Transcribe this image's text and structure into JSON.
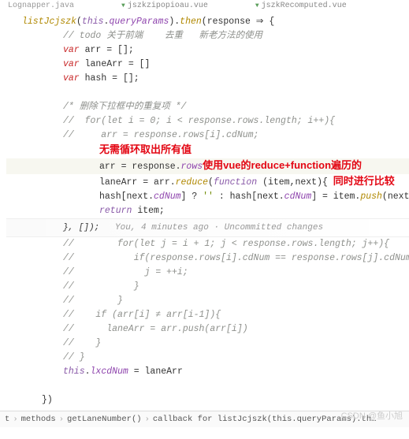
{
  "tabs": {
    "left": "Lognapper.java",
    "mid": "jszkzipopioau.vue",
    "right": "jszkRecomputed.vue"
  },
  "code": {
    "l1_a": "listJcjszk",
    "l1_b": "this",
    "l1_c": "queryParams",
    "l1_d": "then",
    "l1_e": "response",
    "l2": "// todo 关于前端    去重   新老方法的使用",
    "l3_kw": "var",
    "l3_v": "arr",
    "l3_val": " = [];",
    "l4_kw": "var",
    "l4_v": "laneArr",
    "l4_val": " = []",
    "l5_kw": "var",
    "l5_v": "hash",
    "l5_val": " = [];",
    "l6": "/* 删除下拉框中的重复项 */",
    "l7": "//  for(let i = 0; i < response.rows.length; i++){",
    "l8": "//     arr = response.rows[i].cdNum;",
    "anno1": "无需循环取出所有值",
    "l9_a": "arr = response.",
    "l9_b": "rows",
    "anno2": "使用vue的reduce+function遍历的",
    "l10_a": "laneArr = arr.",
    "l10_b": "reduce",
    "l10_c": "function",
    "l10_d": " (item,next){",
    "anno3": "同时进行比较",
    "l11_a": "hash[next.",
    "l11_b": "cdNum",
    "l11_c": "] ? ",
    "l11_d": "''",
    "l11_e": " : hash[next.",
    "l11_f": "cdNum",
    "l11_g": "] = item.",
    "l11_h": "push",
    "l11_i": "(next);",
    "l12_kw": "return",
    "l12_v": " item;",
    "l13": "}, []);",
    "vcs": "You, 4 minutes ago · Uncommitted changes",
    "l14": "//        for(let j = i + 1; j < response.rows.length; j++){",
    "l15": "//           if(response.rows[i].cdNum == response.rows[j].cdNum){",
    "l16": "//             j = ++i;",
    "l17": "//           }",
    "l18": "//        }",
    "l19": "//    if (arr[i] ≠ arr[i-1]){",
    "l20": "//      laneArr = arr.push(arr[i])",
    "l21": "//    }",
    "l22": "// }",
    "l23_a": "this",
    "l23_b": "lxcdNum",
    "l23_c": " = laneArr",
    "l24": "})"
  },
  "breadcrumb": {
    "b1": "t",
    "b2": "methods",
    "b3": "getLaneNumber()",
    "b4": "callback for listJcjszk(this.queryParams).th…"
  },
  "watermark": "CSDN @鱼小旭"
}
